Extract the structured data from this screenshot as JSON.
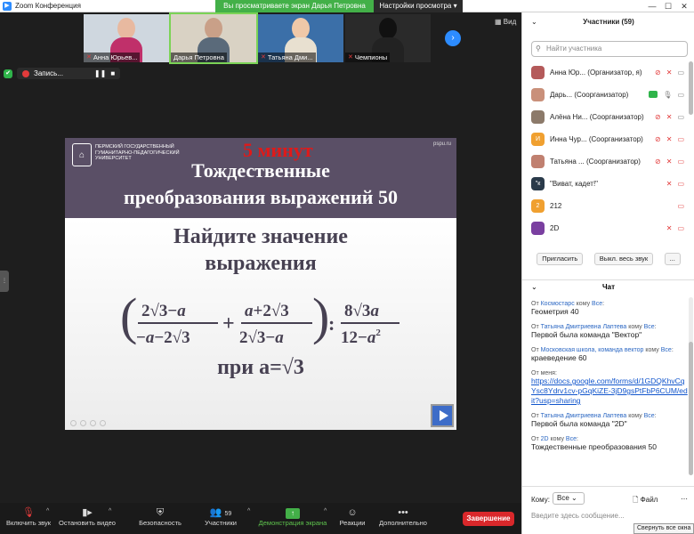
{
  "window": {
    "title": "Zoom Конференция",
    "share_banner": "Вы просматриваете экран Дарья Петровна",
    "view_options": "Настройки просмотра"
  },
  "gallery": {
    "participants": [
      {
        "name": "Анна Юрьев..."
      },
      {
        "name": "Дарья Петровна"
      },
      {
        "name": "Татьяна Дми..."
      },
      {
        "name": "Чемпионы"
      }
    ],
    "view_label": "Вид"
  },
  "recording": {
    "label": "Запись..."
  },
  "slide": {
    "university": "ПЕРМСКИЙ ГОСУДАРСТВЕННЫЙ ГУМАНИТАРНО-ПЕДАГОГИЧЕСКИЙ УНИВЕРСИТЕТ",
    "site": "pspu.ru",
    "timer": "5 минут",
    "title_line1": "Тождественные",
    "title_line2": "преобразования выражений 50",
    "task_line1": "Найдите значение",
    "task_line2": "выражения",
    "condition": "при а=√3"
  },
  "toolbar": {
    "audio": "Включить звук",
    "video": "Остановить видео",
    "security": "Безопасность",
    "participants": "Участники",
    "participants_count": "59",
    "share": "Демонстрация экрана",
    "reactions": "Реакции",
    "more": "Дополнительно",
    "end": "Завершение"
  },
  "participants_panel": {
    "header": "Участники (59)",
    "search_placeholder": "Найти участника",
    "list": [
      {
        "name": "Анна Юр...",
        "role": "(Организатор, я)",
        "avatar_color": "#b45a5a",
        "initial": ""
      },
      {
        "name": "Дарь...",
        "role": "(Соорганизатор)",
        "avatar_color": "#c9907a",
        "initial": ""
      },
      {
        "name": "Алёна Ни...",
        "role": "(Соорганизатор)",
        "avatar_color": "#8c7a6a",
        "initial": ""
      },
      {
        "name": "Инна Чур...",
        "role": "(Соорганизатор)",
        "avatar_color": "#f0a030",
        "initial": "И"
      },
      {
        "name": "Татьяна ...",
        "role": "(Соорганизатор)",
        "avatar_color": "#c08070",
        "initial": ""
      },
      {
        "name": "\"Виват, кадет!\"",
        "role": "",
        "avatar_color": "#2a3a4a",
        "initial": "\"к"
      },
      {
        "name": "212",
        "role": "",
        "avatar_color": "#f0a030",
        "initial": "2"
      },
      {
        "name": "2D",
        "role": "",
        "avatar_color": "#7a3fa0",
        "initial": ""
      }
    ],
    "invite": "Пригласить",
    "mute_all": "Выкл. весь звук",
    "more": "..."
  },
  "chat": {
    "header": "Чат",
    "messages": [
      {
        "from_label": "От",
        "sender": "Космостарс",
        "to_label": "кому",
        "recipient": "Все",
        "text": "Геометрия 40"
      },
      {
        "from_label": "От",
        "sender": "Татьяна Дмитриевна Лаптева",
        "to_label": "кому",
        "recipient": "Все",
        "text": "Первой была команда \"Вектор\""
      },
      {
        "from_label": "От",
        "sender": "Московская школа, команда вектор",
        "to_label": "кому",
        "recipient": "Все",
        "text": "краеведение 60"
      },
      {
        "from_label": "От меня",
        "sender": "",
        "to_label": "",
        "recipient": "",
        "link": "https://docs.google.com/forms/d/1GDQKhvCqYsc8Ydrv1cv-pGqKiZE-3jD9gsPtFbP6CUM/edit?usp=sharing"
      },
      {
        "from_label": "От",
        "sender": "Татьяна Дмитриевна Лаптева",
        "to_label": "кому",
        "recipient": "Все",
        "text": "Первой была команда \"2D\""
      },
      {
        "from_label": "От",
        "sender": "2D",
        "to_label": "кому",
        "recipient": "Все",
        "text": "Тождественные преобразования 50"
      }
    ],
    "to_label": "Кому:",
    "to_value": "Все",
    "file": "Файл",
    "input_placeholder": "Введите здесь сообщение...",
    "collapse_tooltip": "Свернуть все окна"
  }
}
